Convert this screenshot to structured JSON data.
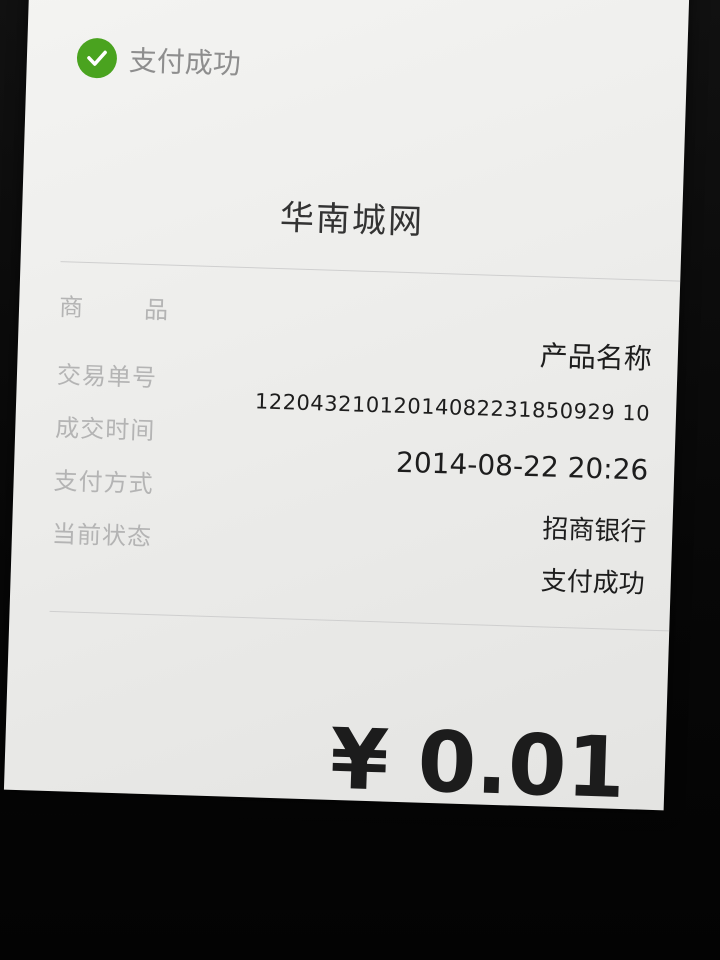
{
  "header": {
    "status_text": "支付成功",
    "status_color": "#4aa31f"
  },
  "merchant": {
    "name": "华南城网"
  },
  "details": {
    "labels": {
      "product_char1": "商",
      "product_char2": "品",
      "order_no": "交易单号",
      "time": "成交时间",
      "method": "支付方式",
      "state": "当前状态"
    },
    "values": {
      "product": "产品名称",
      "order_no": "12204321012014082231850929 10",
      "time": "2014-08-22 20:26",
      "method": "招商银行",
      "state": "支付成功"
    }
  },
  "amount": {
    "display": "¥ 0.01"
  }
}
